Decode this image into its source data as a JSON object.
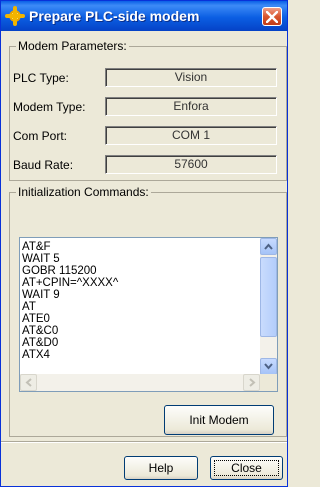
{
  "window": {
    "title": "Prepare PLC-side modem"
  },
  "modem_parameters": {
    "legend": "Modem Parameters:",
    "rows": [
      {
        "label": "PLC Type:",
        "value": "Vision"
      },
      {
        "label": "Modem Type:",
        "value": "Enfora"
      },
      {
        "label": "Com Port:",
        "value": "COM 1"
      },
      {
        "label": "Baud Rate:",
        "value": "57600"
      }
    ]
  },
  "init_commands": {
    "legend": "Initialization Commands:",
    "lines": [
      "AT&F",
      "WAIT 5",
      "GOBR 115200",
      "AT+CPIN=^XXXX^",
      "WAIT 9",
      "AT",
      "ATE0",
      "AT&C0",
      "AT&D0",
      "ATX4"
    ]
  },
  "buttons": {
    "init_modem": "Init Modem",
    "help": "Help",
    "close": "Close"
  },
  "icons": {
    "app": "gear-sun-icon",
    "close": "close-icon"
  },
  "colors": {
    "titlebar": "#0b5ee3",
    "close_button": "#d9562e",
    "dialog_bg": "#ece9d8"
  }
}
